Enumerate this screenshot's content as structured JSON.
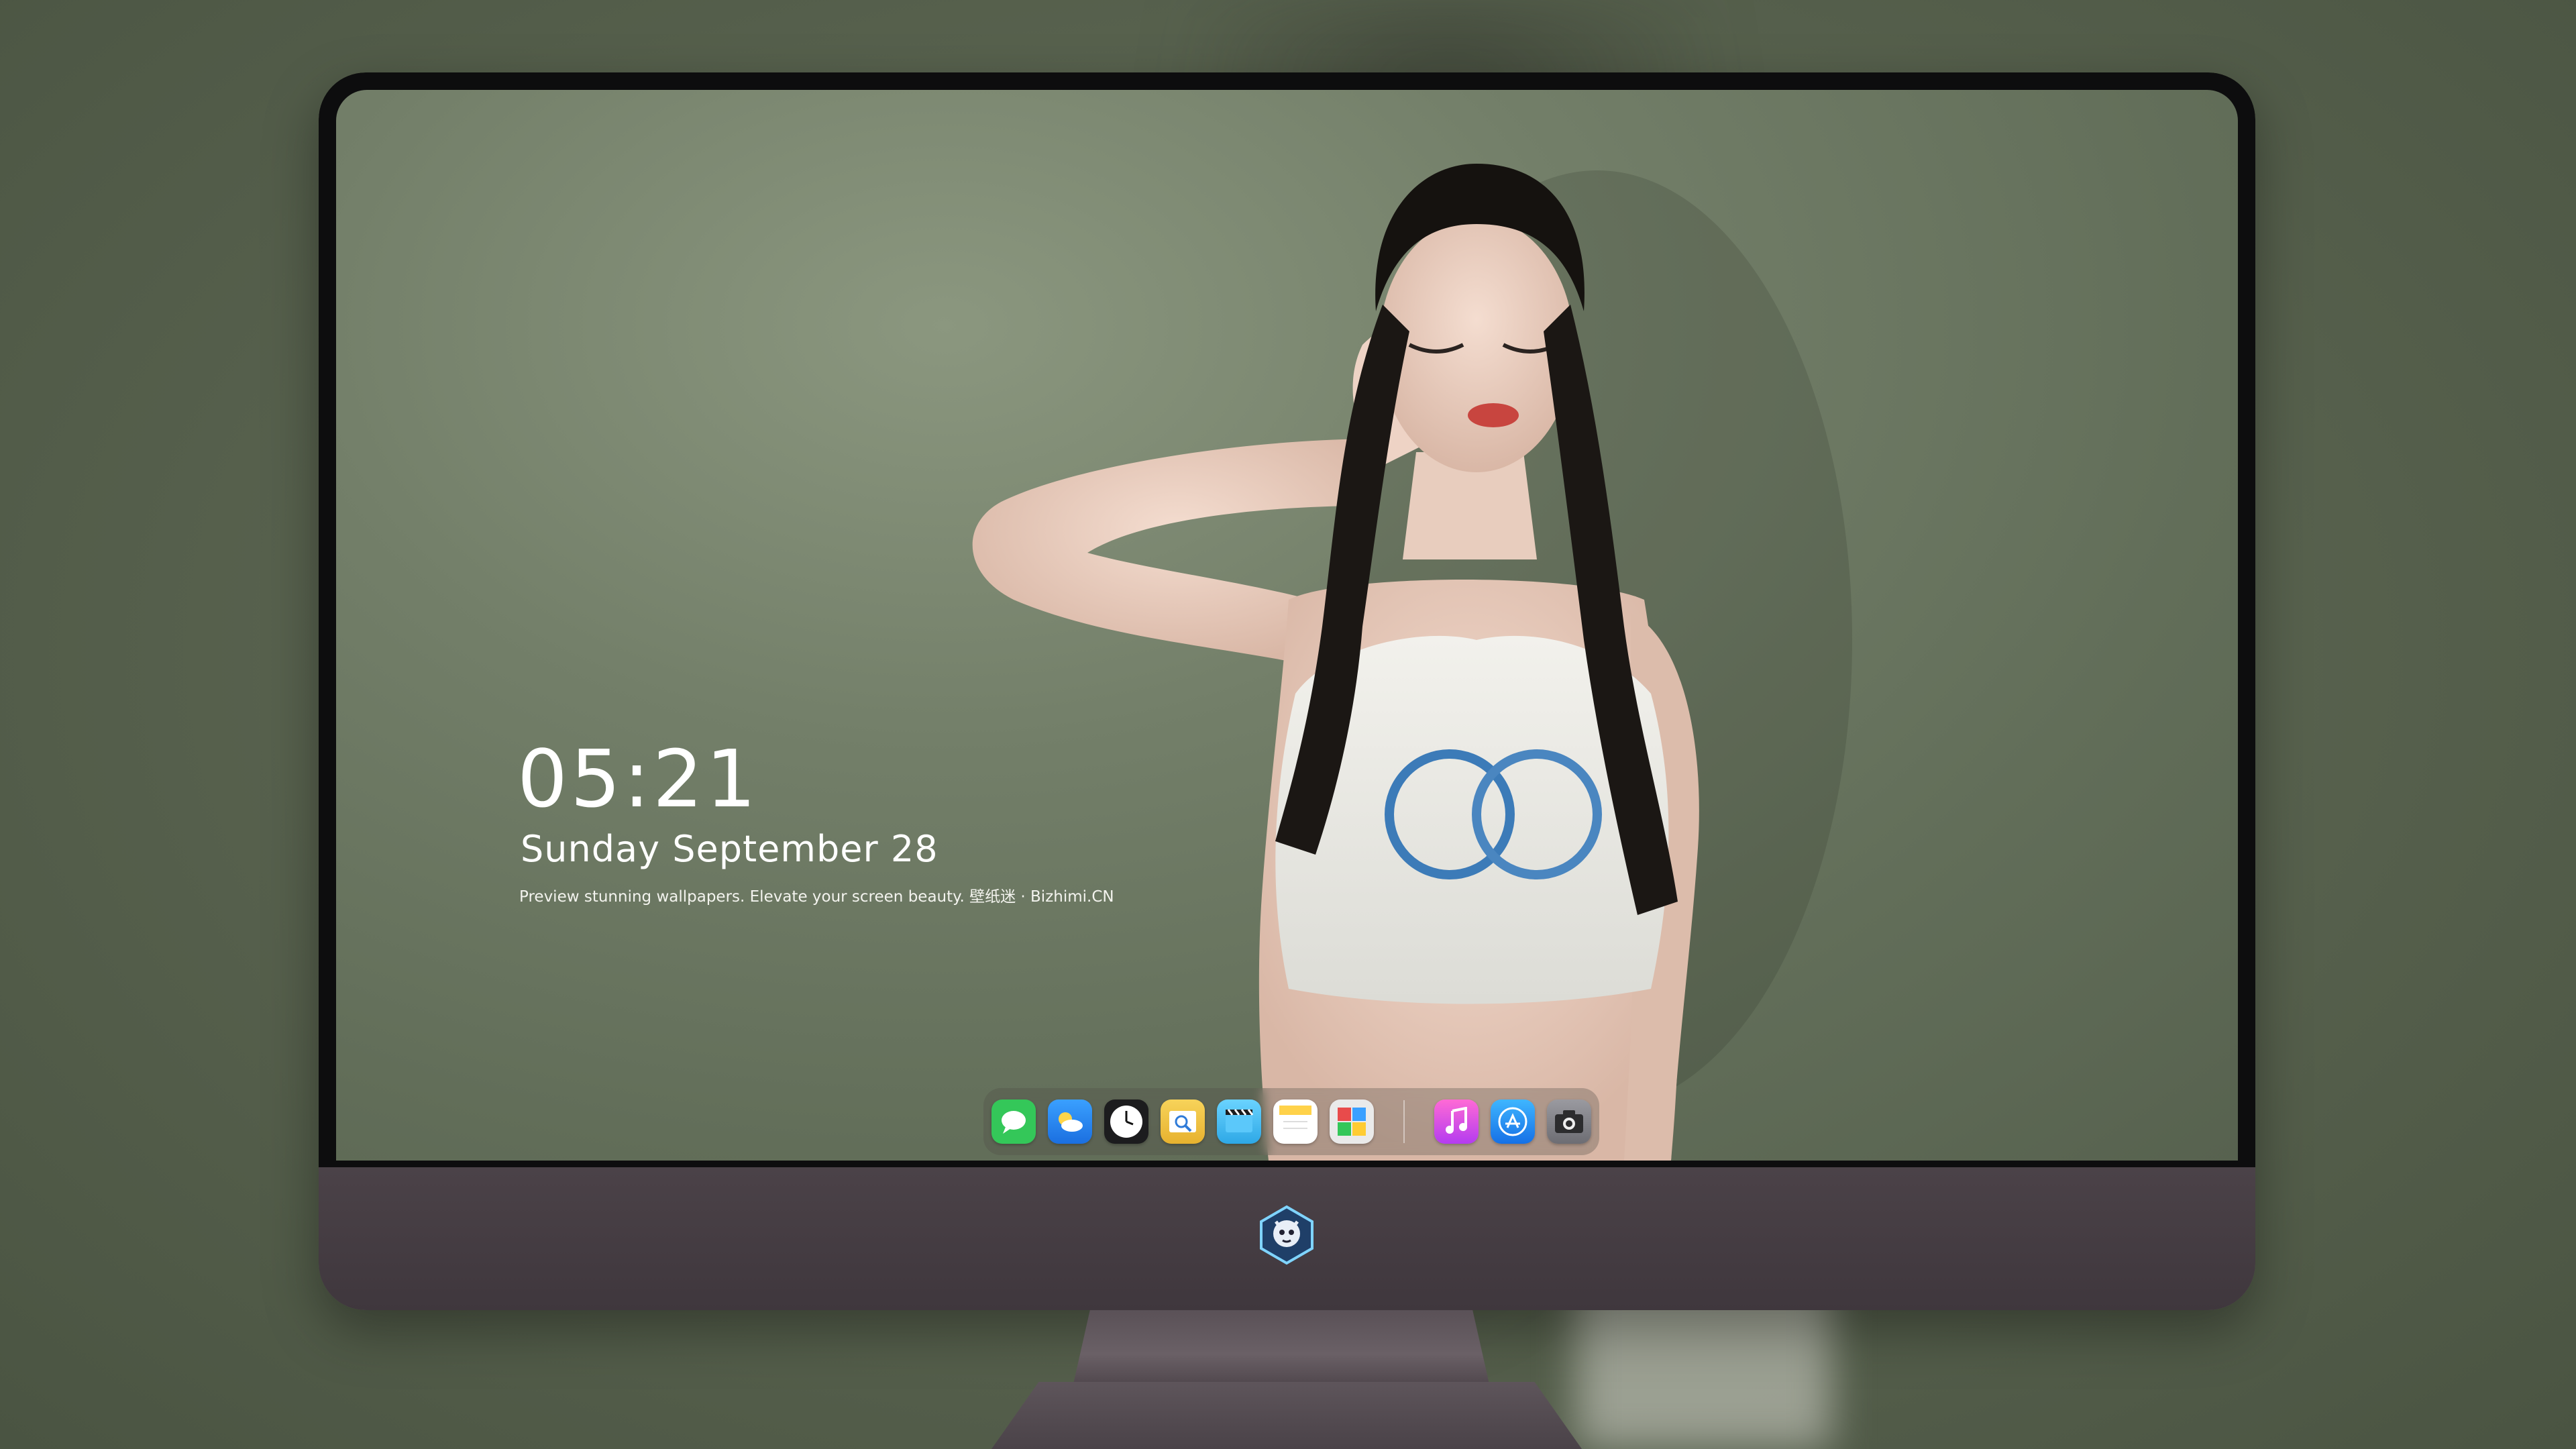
{
  "lockscreen": {
    "time": "05:21",
    "date": "Sunday September  28",
    "tagline": "Preview stunning wallpapers. Elevate your screen beauty. 壁纸迷 · Bizhimi.CN"
  },
  "dock": {
    "apps": [
      {
        "name": "messages-icon",
        "color": "#34c759"
      },
      {
        "name": "weather-icon",
        "color": "#2f8ff2"
      },
      {
        "name": "clock-icon",
        "color": "#1c1c1e"
      },
      {
        "name": "preview-icon",
        "color": "#f7c948"
      },
      {
        "name": "clips-icon",
        "color": "#5ac8fa"
      },
      {
        "name": "notes-icon",
        "color": "#ffd24a"
      },
      {
        "name": "photo-booth-icon",
        "color": "#e8e8e8"
      },
      {
        "name": "music-icon",
        "color": "#e84dd2"
      },
      {
        "name": "app-store-icon",
        "color": "#1e88f3"
      },
      {
        "name": "camera-icon",
        "color": "#8e8e93"
      }
    ]
  }
}
